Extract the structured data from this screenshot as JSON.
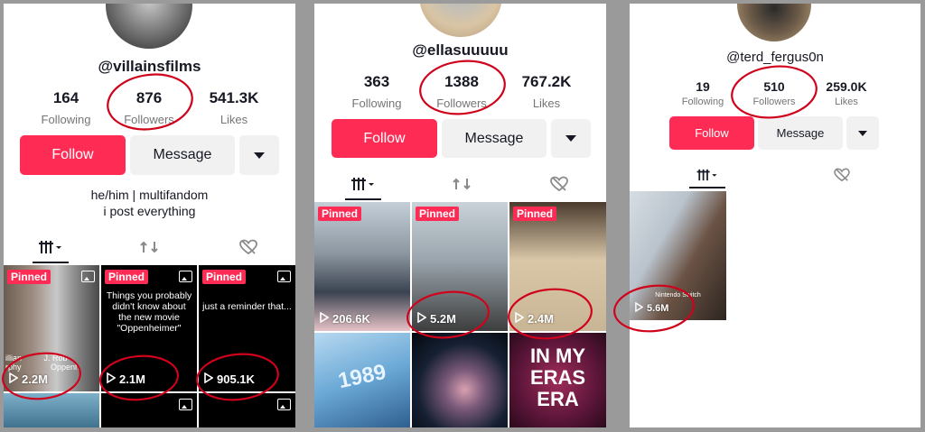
{
  "panels": [
    {
      "username": "@villainsfilms",
      "stats": [
        {
          "value": "164",
          "label": "Following"
        },
        {
          "value": "876",
          "label": "Followers"
        },
        {
          "value": "541.3K",
          "label": "Likes"
        }
      ],
      "follow_label": "Follow",
      "message_label": "Message",
      "bio": [
        "he/him | multifandom",
        "i post everything"
      ],
      "videos": [
        {
          "pinned": "Pinned",
          "views": "2.2M",
          "text_lines": [
            "illian",
            "rphy",
            "J. Rob",
            "Oppenh"
          ]
        },
        {
          "pinned": "Pinned",
          "views": "2.1M",
          "text": "Things you probably didn't know about the new movie \"Oppenheimer\""
        },
        {
          "pinned": "Pinned",
          "views": "905.1K",
          "text": "just a reminder that..."
        }
      ]
    },
    {
      "username": "@ellasuuuuu",
      "stats": [
        {
          "value": "363",
          "label": "Following"
        },
        {
          "value": "1388",
          "label": "Followers"
        },
        {
          "value": "767.2K",
          "label": "Likes"
        }
      ],
      "follow_label": "Follow",
      "message_label": "Message",
      "videos": [
        {
          "pinned": "Pinned",
          "views": "206.6K"
        },
        {
          "pinned": "Pinned",
          "views": "5.2M"
        },
        {
          "pinned": "Pinned",
          "views": "2.4M"
        },
        {
          "views": "",
          "text": "1989"
        },
        {
          "views": ""
        },
        {
          "views": "",
          "text_lines": [
            "IN MY",
            "ERAS ERA"
          ]
        }
      ]
    },
    {
      "username": "@terd_fergus0n",
      "stats": [
        {
          "value": "19",
          "label": "Following"
        },
        {
          "value": "510",
          "label": "Followers"
        },
        {
          "value": "259.0K",
          "label": "Likes"
        }
      ],
      "follow_label": "Follow",
      "message_label": "Message",
      "videos": [
        {
          "views": "5.6M",
          "text_lines": [
            "Nintendo Switch"
          ]
        }
      ]
    }
  ],
  "colors": {
    "accent": "#fe2c55",
    "annotation": "#d0021b"
  }
}
